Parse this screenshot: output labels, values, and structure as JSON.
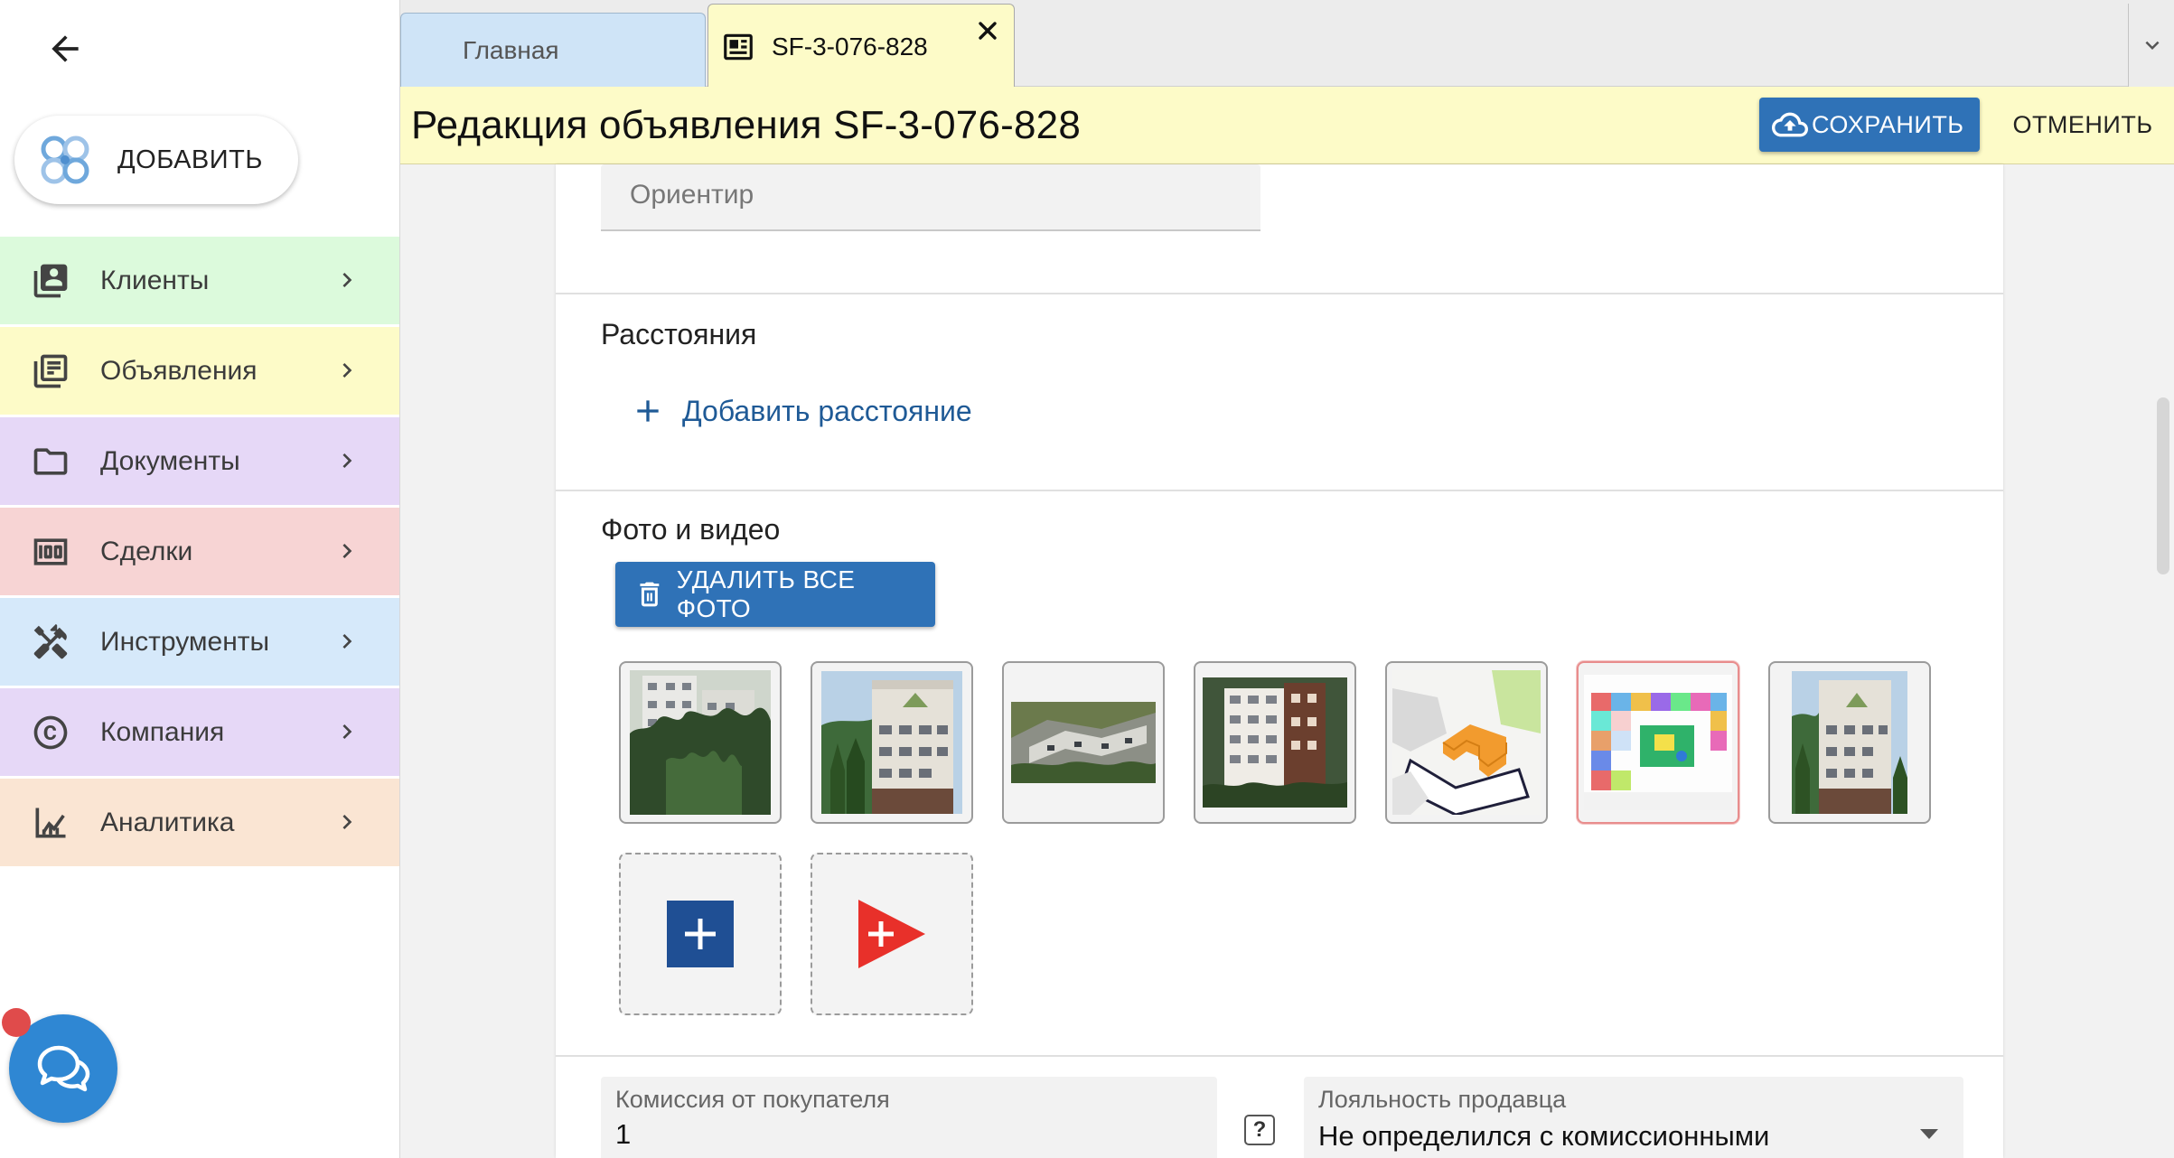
{
  "sidebar": {
    "add_label": "ДОБАВИТЬ",
    "items": [
      {
        "label": "Клиенты",
        "icon": "contacts-icon",
        "color": "#dcfadc"
      },
      {
        "label": "Объявления",
        "icon": "listing-icon",
        "color": "#fdfbc8"
      },
      {
        "label": "Документы",
        "icon": "folder-icon",
        "color": "#e6d8f7"
      },
      {
        "label": "Сделки",
        "icon": "money-icon",
        "color": "#f7d4d4"
      },
      {
        "label": "Инструменты",
        "icon": "tools-icon",
        "color": "#d6e9fa"
      },
      {
        "label": "Компания",
        "icon": "copyright-icon",
        "color": "#e6d8f7"
      },
      {
        "label": "Аналитика",
        "icon": "analytics-icon",
        "color": "#fae5d3"
      }
    ]
  },
  "tabs": {
    "home_label": "Главная",
    "active_label": "SF-3-076-828"
  },
  "header": {
    "title": "Редакция объявления SF-3-076-828",
    "save_label": "СОХРАНИТЬ",
    "cancel_label": "ОТМЕНИТЬ"
  },
  "form": {
    "landmark_placeholder": "Ориентир",
    "distances_title": "Расстояния",
    "add_distance_label": "Добавить расстояние",
    "media_title": "Фото и видео",
    "delete_all_label": "УДАЛИТЬ ВСЕ ФОТО",
    "commission_label": "Комиссия от покупателя",
    "commission_value": "1",
    "help_label": "?",
    "loyalty_label": "Лояльность продавца",
    "loyalty_value": "Не определился с комиссионными"
  },
  "colors": {
    "accent": "#2f72b7",
    "header_bg": "#fdfbc8",
    "link": "#1f5a96",
    "chat": "#2f87d3"
  }
}
